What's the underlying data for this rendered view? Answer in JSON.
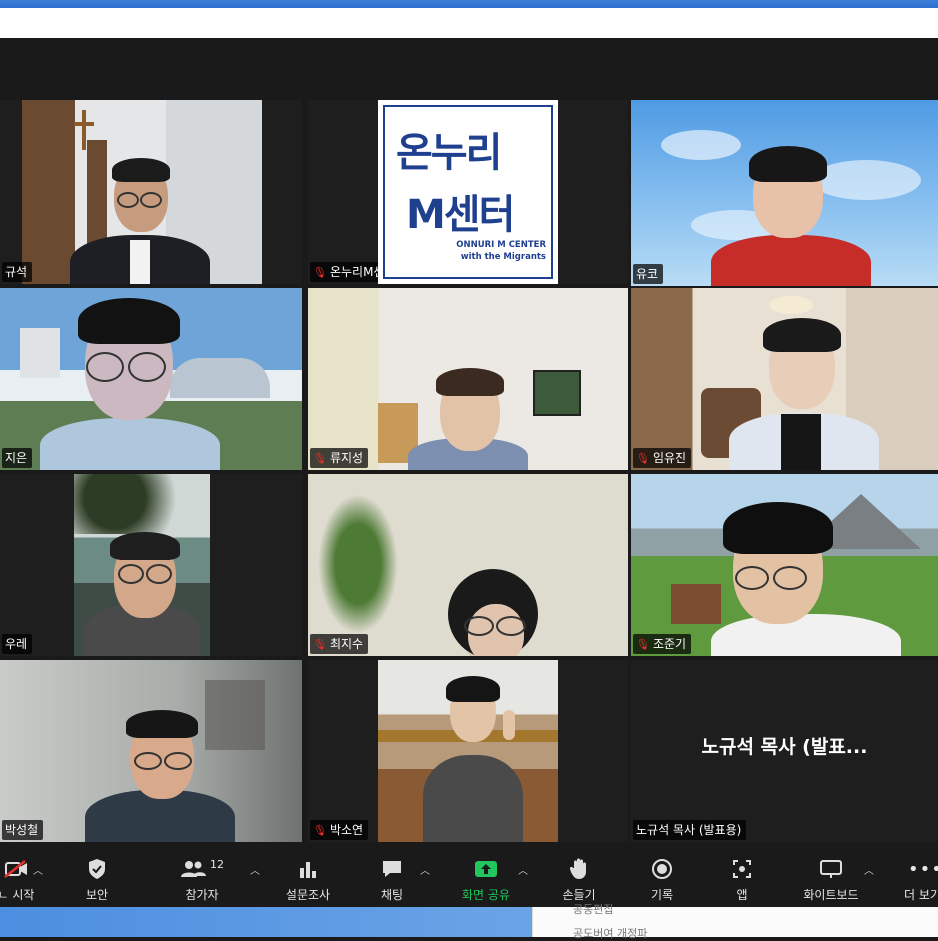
{
  "participants": [
    {
      "name": "규석",
      "muted": false
    },
    {
      "name": "온누리M센터",
      "muted": true
    },
    {
      "name": "유코",
      "muted": false
    },
    {
      "name": "지은",
      "muted": false
    },
    {
      "name": "류지성",
      "muted": true
    },
    {
      "name": "임유진",
      "muted": true
    },
    {
      "name": "우레",
      "muted": false
    },
    {
      "name": "최지수",
      "muted": true
    },
    {
      "name": "조준기",
      "muted": true
    },
    {
      "name": "박성철",
      "muted": false
    },
    {
      "name": "박소연",
      "muted": true
    },
    {
      "name": "노규석 목사 (발표용)",
      "muted": false
    }
  ],
  "logo": {
    "line1": "온누리",
    "line2": "M센터",
    "sub1": "ONNURI M CENTER",
    "sub2": "with the Migrants"
  },
  "presenter_display": "노규석 목사 (발표...",
  "toolbar": {
    "start_label": "ㄴ 시작",
    "security_label": "보안",
    "participants_label": "참가자",
    "participants_count": "12",
    "polls_label": "설문조사",
    "chat_label": "채팅",
    "share_label": "화면 공유",
    "raise_hand_label": "손들기",
    "record_label": "기록",
    "apps_label": "앱",
    "whiteboard_label": "화이트보드",
    "more_label": "더 보기"
  },
  "document": {
    "line1": "공동편집",
    "line2": "공도버여 개정파"
  },
  "colors": {
    "active_speaker": "#d7e86b",
    "share_green": "#22c55e",
    "mute_red": "#e0322b",
    "toolbar_bg": "#1a1a1a"
  }
}
